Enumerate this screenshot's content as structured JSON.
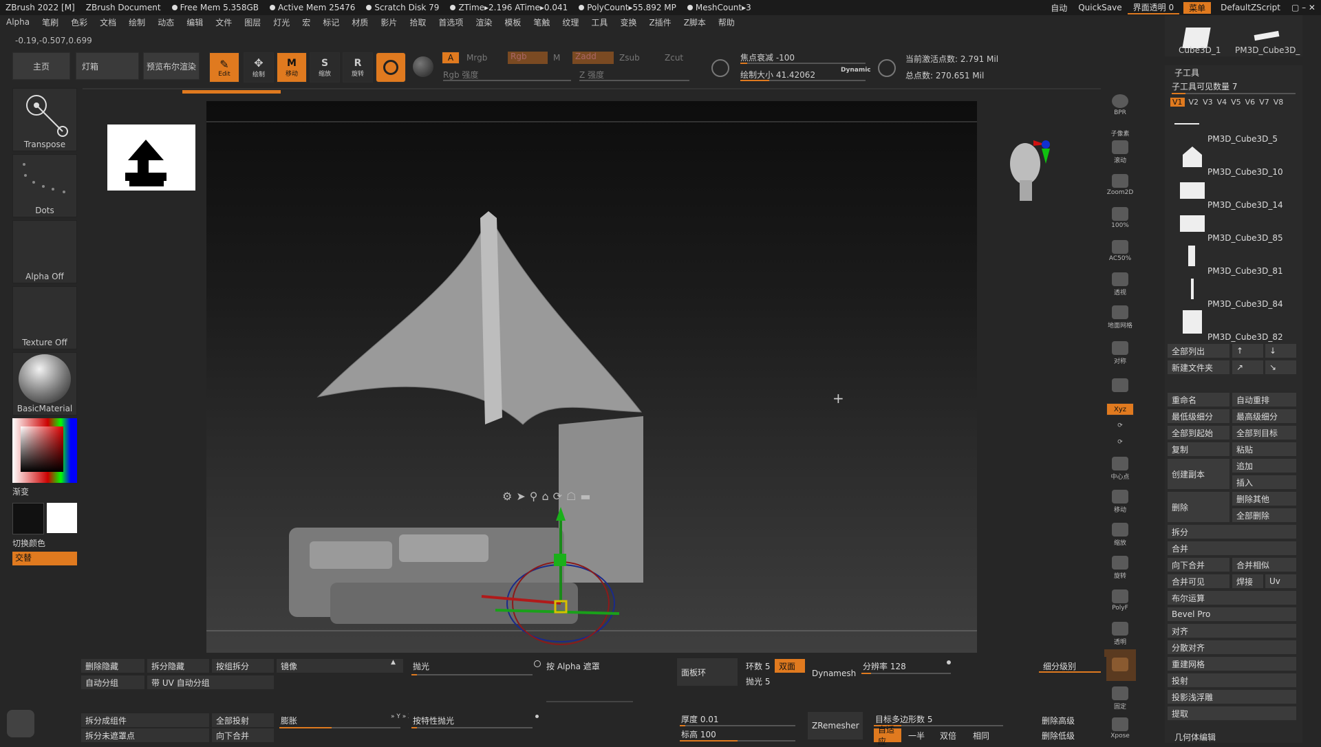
{
  "titlebar": {
    "app": "ZBrush 2022 [M]",
    "doc": "ZBrush Document",
    "free_mem": "Free Mem 5.358GB",
    "active_mem": "Active Mem 25476",
    "scratch": "Scratch Disk 79",
    "ztime": "ZTime▸2.196 ATime▸0.041",
    "polycount": "PolyCount▸55.892 MP",
    "meshcount": "MeshCount▸3",
    "auto": "自动",
    "quicksave": "QuickSave",
    "transparency": "界面透明 0",
    "menu": "菜单",
    "script": "DefaultZScript"
  },
  "menubar": [
    "Alpha",
    "笔刷",
    "色彩",
    "文档",
    "绘制",
    "动态",
    "编辑",
    "文件",
    "图层",
    "灯光",
    "宏",
    "标记",
    "材质",
    "影片",
    "拾取",
    "首选项",
    "渲染",
    "模板",
    "笔触",
    "纹理",
    "工具",
    "变换",
    "Z插件",
    "Z脚本",
    "帮助"
  ],
  "coords": "-0.19,-0.507,0.699",
  "toolbar": {
    "home": "主页",
    "lightbox": "灯箱",
    "bpr": "预览布尔渲染",
    "edit": "Edit",
    "draw": "绘制",
    "move": "移动",
    "scale": "缩放",
    "rotate": "旋转",
    "a": "A",
    "mrgb": "Mrgb",
    "rgb": "Rgb",
    "m": "M",
    "zadd": "Zadd",
    "zsub": "Zsub",
    "zcut": "Zcut",
    "rgb_intensity": "Rgb 强度",
    "z_intensity": "Z 强度",
    "focal": "焦点衰减 -100",
    "draw_size": "绘制大小 41.42062",
    "dynamic": "Dynamic",
    "active_points": "当前激活点数: 2.791 Mil",
    "total_points": "总点数: 270.651 Mil"
  },
  "left": {
    "transpose": "Transpose",
    "dots": "Dots",
    "alpha_off": "Alpha Off",
    "texture_off": "Texture Off",
    "material": "BasicMaterial",
    "gradient": "渐变",
    "switch_color": "切换颜色",
    "alternate": "交替"
  },
  "right_tools": [
    "BPR",
    "子像素",
    "滚动",
    "Zoom2D",
    "100%",
    "AC50%",
    "透视",
    "地面网格",
    "对称",
    "",
    "Xyz",
    "",
    "",
    "中心点",
    "移动",
    "缩放",
    "旋转",
    "PolyF",
    "透明",
    "实体",
    "固定",
    "Xpose"
  ],
  "subtool": {
    "top_items": [
      "Cube3D_1",
      "PM3D_Cube3D_"
    ],
    "header": "子工具",
    "visible_count": "子工具可见数量 7",
    "versions": [
      "V1",
      "V2",
      "V3",
      "V4",
      "V5",
      "V6",
      "V7",
      "V8"
    ],
    "items": [
      "PM3D_Cube3D_5",
      "PM3D_Cube3D_10",
      "PM3D_Cube3D_14",
      "PM3D_Cube3D_85",
      "PM3D_Cube3D_81",
      "PM3D_Cube3D_84",
      "PM3D_Cube3D_82"
    ],
    "list_all": "全部列出",
    "new_folder": "新建文件夹",
    "rename": "重命名",
    "auto_reorder": "自动重排",
    "lowest_sub": "最低级细分",
    "highest_sub": "最高级细分",
    "all_to_start": "全部到起始",
    "all_to_target": "全部到目标",
    "copy": "复制",
    "paste": "粘贴",
    "duplicate": "创建副本",
    "append": "追加",
    "insert": "插入",
    "delete": "删除",
    "delete_other": "删除其他",
    "delete_all": "全部删除",
    "split": "拆分",
    "merge": "合并",
    "merge_down": "向下合并",
    "merge_similar": "合并相似",
    "merge_visible": "合并可见",
    "weld": "焊接",
    "uv": "Uv",
    "boolean": "布尔运算",
    "bevel": "Bevel Pro",
    "align": "对齐",
    "distribute": "分散对齐",
    "remesh": "重建网格",
    "project": "投射",
    "project_bas": "投影浅浮雕",
    "extract": "提取",
    "geometry": "几何体编辑"
  },
  "bottom": {
    "del_hidden": "删除隐藏",
    "split_hidden": "拆分隐藏",
    "split_groups": "按组拆分",
    "mirror": "镜像",
    "polish": "抛光",
    "alpha_mask": "按 Alpha 遮罩",
    "panel_loops": "面板环",
    "loops": "环数 5",
    "double": "双面",
    "polish5": "抛光 5",
    "dynamesh": "Dynamesh",
    "resolution": "分辨率 128",
    "auto_group": "自动分组",
    "uv_group": "带 UV 自动分组",
    "split_parts": "拆分成组件",
    "split_unmasked": "拆分未遮罩点",
    "project_all": "全部投射",
    "merge_down": "向下合并",
    "inflate": "膨胀",
    "feature_polish": "按特性抛光",
    "thickness": "厚度 0.01",
    "height": "标高 100",
    "zremesher": "ZRemesher",
    "target_poly": "目标多边形数 5",
    "adaptive": "自适应",
    "half": "一半",
    "same": "双倍",
    "similar": "相同",
    "sub_level": "细分级别",
    "del_higher": "删除高级",
    "del_lower": "删除低级",
    "xyz_label": "» Y » Z"
  },
  "colors": {
    "accent": "#e07a1f",
    "primary": "#111111",
    "secondary": "#ffffff"
  }
}
